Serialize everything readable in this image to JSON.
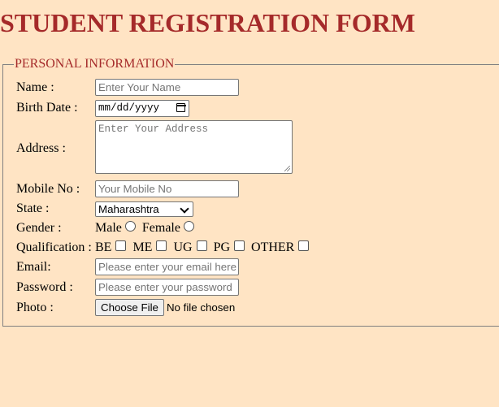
{
  "page_title": "STUDENT REGISTRATION FORM",
  "section_legend": "PERSONAL INFORMATION",
  "colors": {
    "background": "#ffe4c4",
    "heading": "#a52a2a",
    "border": "#808080"
  },
  "fields": {
    "name": {
      "label": "Name :",
      "placeholder": "Enter Your Name"
    },
    "birth_date": {
      "label": "Birth Date :",
      "value": "mm/dd/yyyy",
      "icon": "calendar-icon"
    },
    "address": {
      "label": "Address :",
      "placeholder": "Enter Your Address"
    },
    "mobile": {
      "label": "Mobile No :",
      "placeholder": "Your Mobile No"
    },
    "state": {
      "label": "State :",
      "selected": "Maharashtra"
    },
    "gender": {
      "label": "Gender :",
      "options": [
        "Male",
        "Female"
      ]
    },
    "qualification": {
      "label": "Qualification :",
      "options": [
        "BE",
        "ME",
        "UG",
        "PG",
        "OTHER"
      ]
    },
    "email": {
      "label": "Email:",
      "placeholder": "Please enter your email here"
    },
    "password": {
      "label": "Password :",
      "placeholder": "Please enter your password"
    },
    "photo": {
      "label": "Photo :",
      "button": "Choose File",
      "status": "No file chosen"
    }
  }
}
